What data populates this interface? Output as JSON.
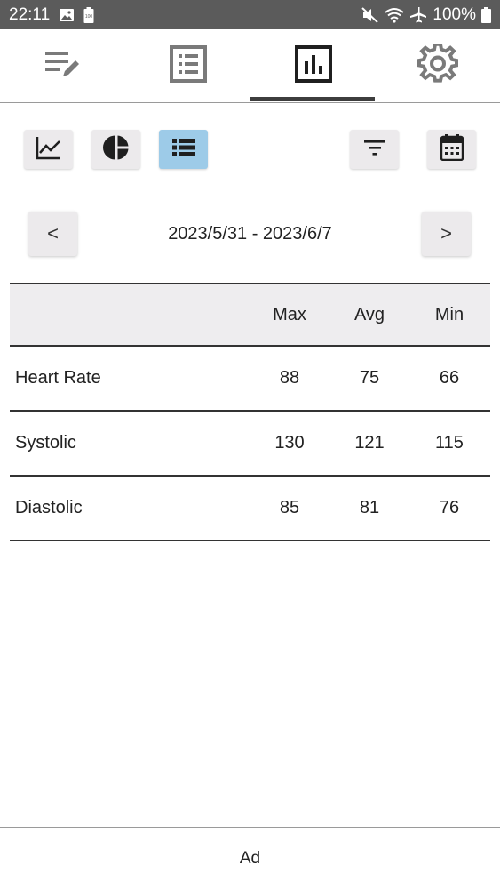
{
  "status_bar": {
    "time": "22:11",
    "battery_percent": "100%",
    "icons": [
      "image-icon",
      "battery-saver-icon",
      "mute-icon",
      "wifi-icon",
      "airplane-mode-icon",
      "battery-icon"
    ]
  },
  "tabs": [
    {
      "name": "edit-list-icon",
      "active": false
    },
    {
      "name": "list-icon",
      "active": false
    },
    {
      "name": "bar-chart-icon",
      "active": true
    },
    {
      "name": "settings-icon",
      "active": false
    }
  ],
  "toolbar": {
    "views": [
      {
        "name": "line-chart-icon",
        "active": false
      },
      {
        "name": "pie-chart-icon",
        "active": false
      },
      {
        "name": "table-list-icon",
        "active": true
      }
    ],
    "filter_icon": "filter-icon",
    "calendar_icon": "calendar-icon",
    "active_color": "#9dcbe8"
  },
  "date_nav": {
    "prev_label": "<",
    "next_label": ">",
    "range": "2023/5/31 - 2023/6/7"
  },
  "table": {
    "headers": [
      "",
      "Max",
      "Avg",
      "Min"
    ],
    "rows": [
      {
        "label": "Heart Rate",
        "max": "88",
        "avg": "75",
        "min": "66"
      },
      {
        "label": "Systolic",
        "max": "130",
        "avg": "121",
        "min": "115"
      },
      {
        "label": "Diastolic",
        "max": "85",
        "avg": "81",
        "min": "76"
      }
    ]
  },
  "ad": {
    "label": "Ad"
  }
}
